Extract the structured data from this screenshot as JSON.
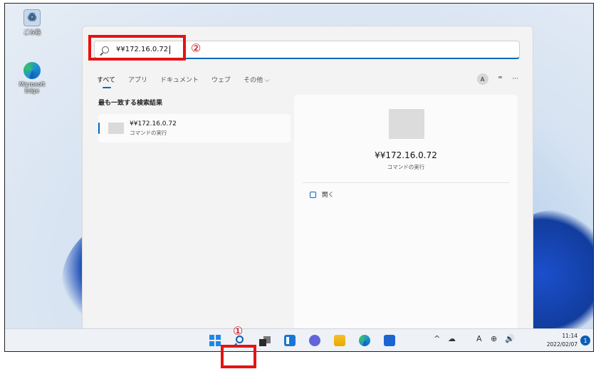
{
  "desktop": {
    "icons": [
      {
        "label": "ごみ箱",
        "icon": "recycle-bin-icon"
      },
      {
        "label": "Microsoft Edge",
        "icon": "edge-icon"
      }
    ]
  },
  "search": {
    "query": "¥¥172.16.0.72",
    "placeholder": ""
  },
  "tabs": {
    "items": [
      "すべて",
      "アプリ",
      "ドキュメント",
      "ウェブ",
      "その他 ⌵"
    ],
    "active": "すべて",
    "avatar": "A",
    "share_icon": "ꟹ",
    "more": "···"
  },
  "results": {
    "section_title": "最も一致する検索結果",
    "best": {
      "title": "¥¥172.16.0.72",
      "subtitle": "コマンドの実行"
    }
  },
  "preview": {
    "title": "¥¥172.16.0.72",
    "subtitle": "コマンドの実行",
    "action_label": "開く"
  },
  "taskbar": {
    "tray": [
      "^",
      "☁",
      "A",
      "⊕",
      "🔊"
    ],
    "time": "11:14",
    "date": "2022/02/07",
    "notification_count": "1"
  },
  "annotations": {
    "one": "①",
    "two": "②"
  },
  "colors": {
    "accent": "#0067c0",
    "highlight": "#e51313"
  }
}
